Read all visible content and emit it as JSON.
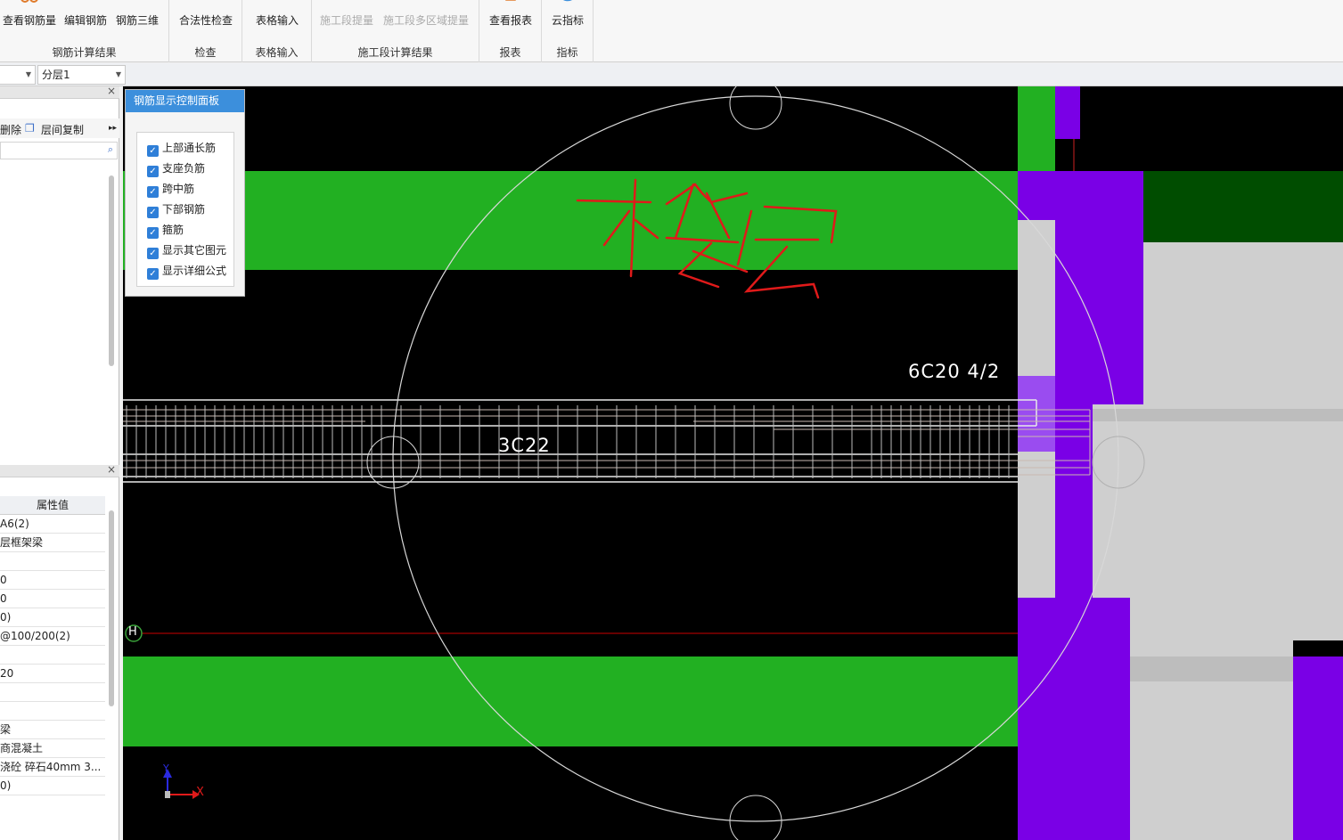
{
  "ribbon": {
    "groups": [
      {
        "label": "钢筋计算结果",
        "buttons": [
          "查看钢筋量",
          "编辑钢筋",
          "钢筋三维"
        ]
      },
      {
        "label": "检查",
        "buttons": [
          "合法性检查"
        ]
      },
      {
        "label": "表格输入",
        "buttons": [
          "表格输入"
        ]
      },
      {
        "label": "施工段计算结果",
        "buttons": [
          "施工段提量",
          "施工段多区域提量"
        ]
      },
      {
        "label": "报表",
        "buttons": [
          "查看报表"
        ]
      },
      {
        "label": "指标",
        "buttons": [
          "云指标"
        ]
      }
    ]
  },
  "selector": {
    "floor_value": "",
    "layer_value": "分层1"
  },
  "left_panel": {
    "toolbar": {
      "delete_label": "删除",
      "copy_label": "层间复制"
    },
    "properties": {
      "header": "属性值",
      "rows": [
        "A6(2)",
        "层框架梁",
        "",
        "0",
        "0",
        "0)",
        "@100/200(2)",
        "",
        "20",
        "",
        "",
        "梁",
        "商混凝土",
        "浇砼 碎石40mm 3...",
        "0)"
      ]
    }
  },
  "control_panel": {
    "title": "钢筋显示控制面板",
    "options": [
      {
        "label": "上部通长筋",
        "checked": true
      },
      {
        "label": "支座负筋",
        "checked": true
      },
      {
        "label": "跨中筋",
        "checked": true
      },
      {
        "label": "下部钢筋",
        "checked": true
      },
      {
        "label": "箍筋",
        "checked": true
      },
      {
        "label": "显示其它图元",
        "checked": true
      },
      {
        "label": "显示详细公式",
        "checked": true
      }
    ]
  },
  "canvas": {
    "rebar_label_top": "6C20 4/2",
    "rebar_label_mid": "3C22",
    "axis_marker": "H",
    "ucs_x": "X",
    "ucs_y": "Y",
    "colors": {
      "green": "#22b022",
      "purple": "#7a00e6",
      "gray": "#cfcfcf",
      "darkgreen": "#004d00",
      "annotation": "#e01a1a"
    }
  }
}
